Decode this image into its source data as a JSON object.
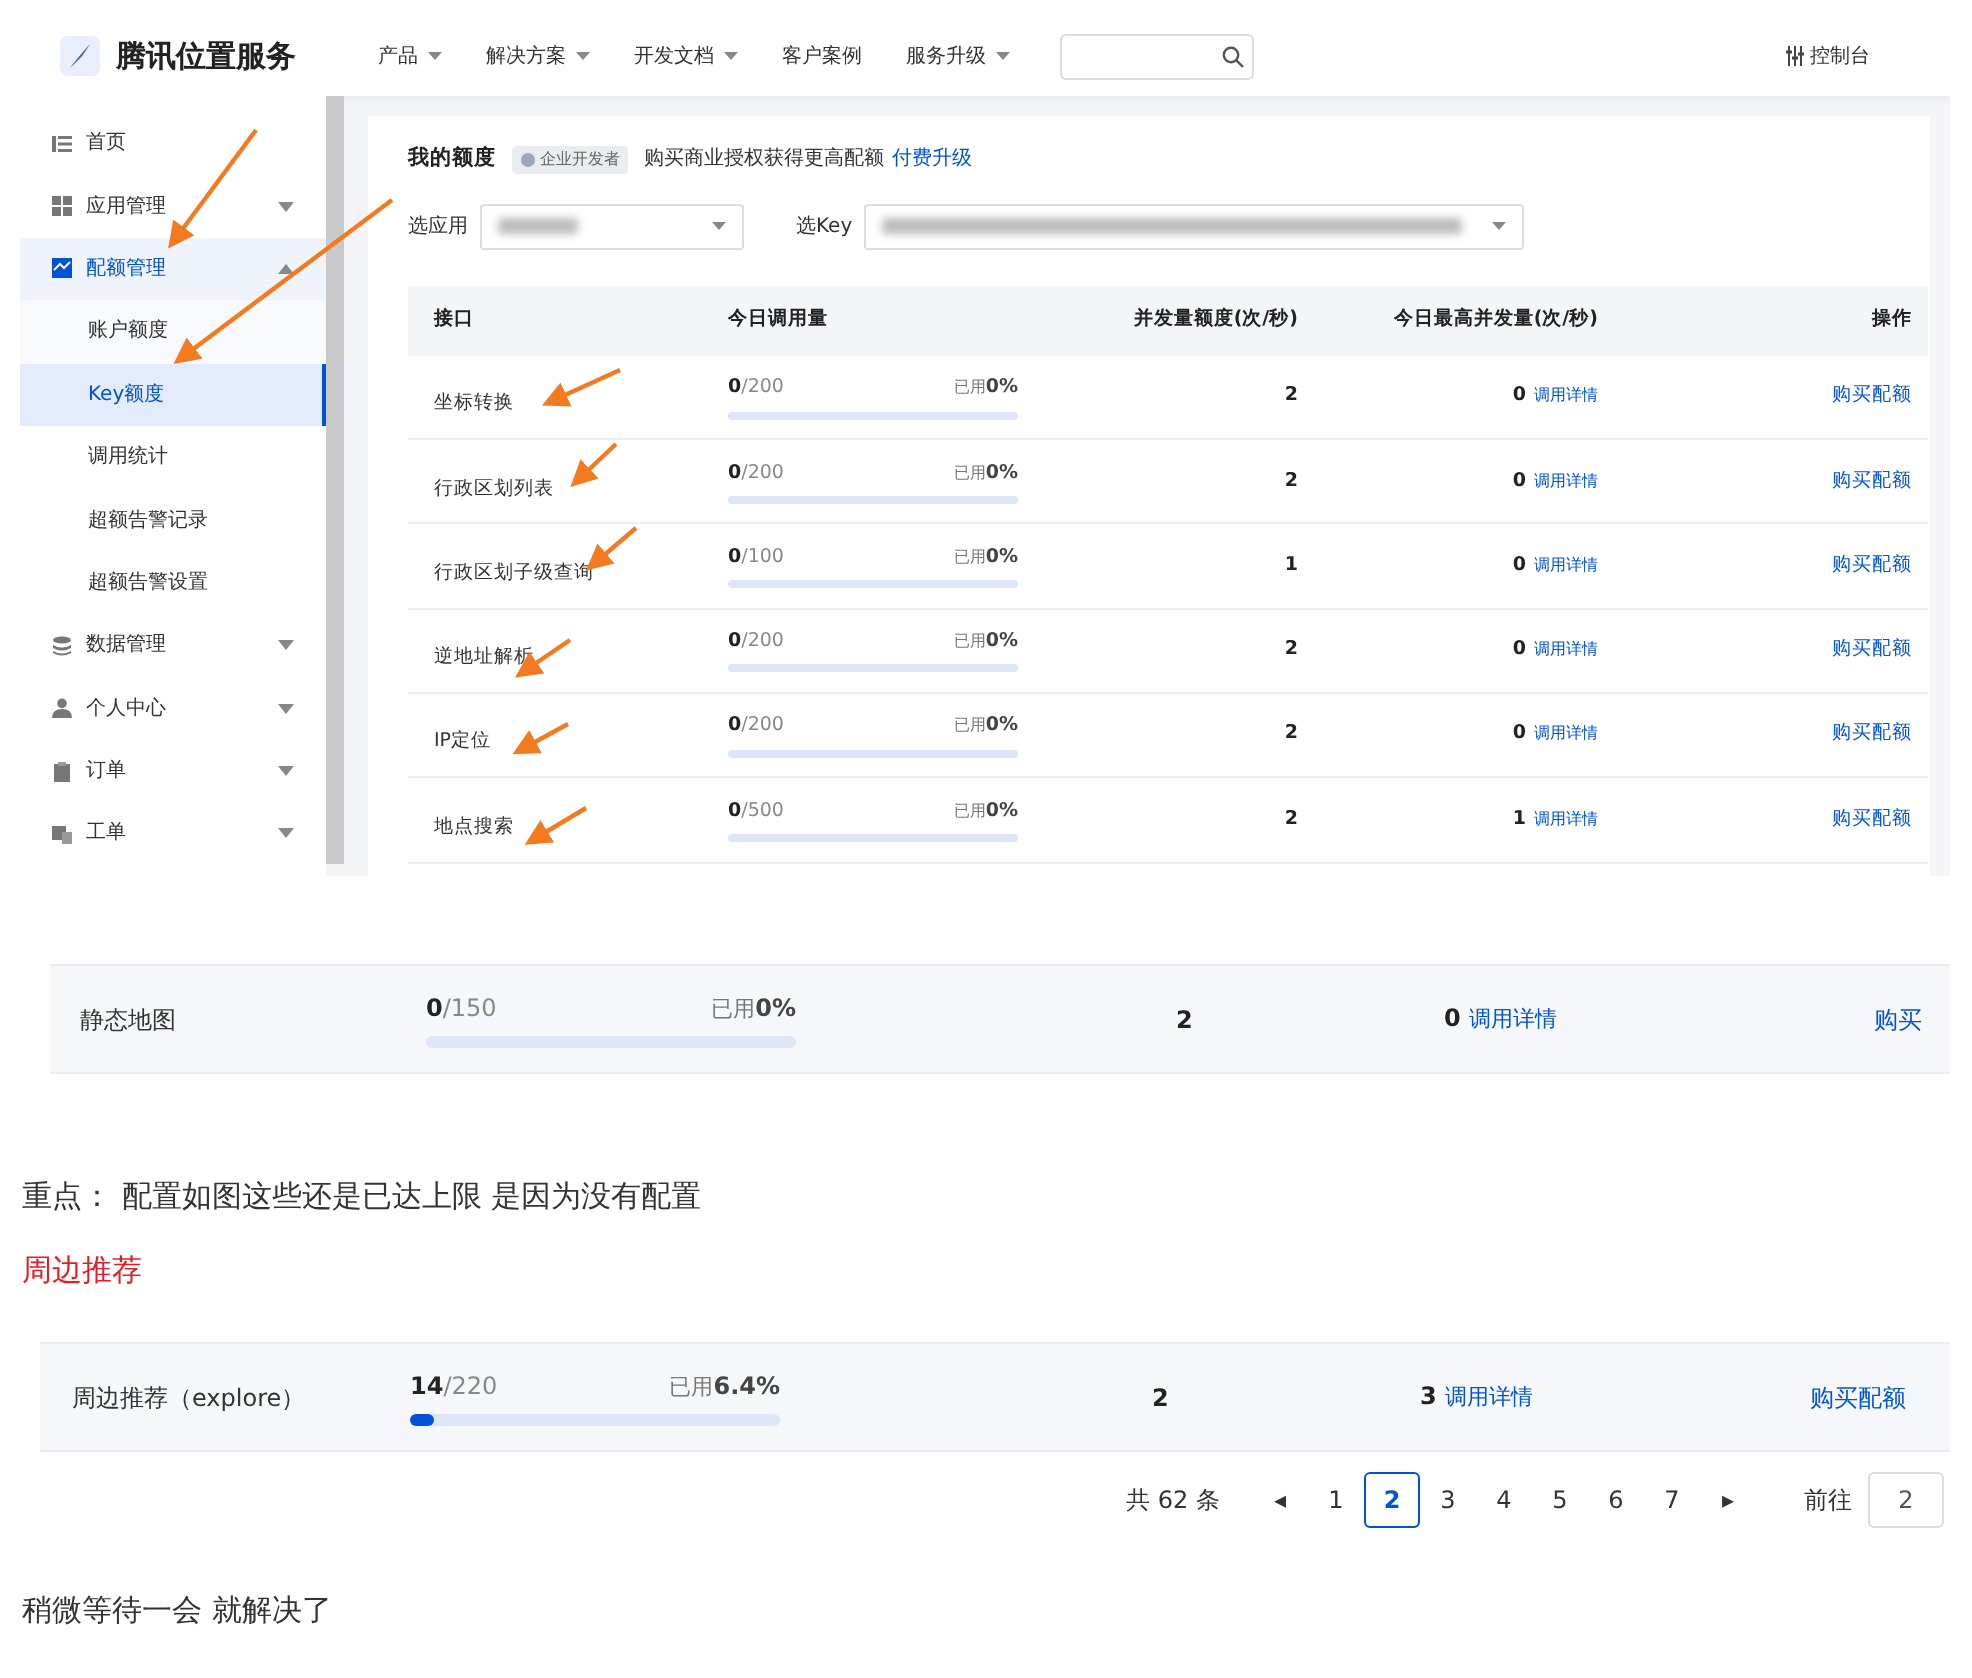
{
  "screenshot_1": {
    "header": {
      "logo_text": "腾讯位置服务",
      "nav": [
        {
          "label": "产品",
          "dropdown": true
        },
        {
          "label": "解决方案",
          "dropdown": true
        },
        {
          "label": "开发文档",
          "dropdown": true
        },
        {
          "label": "客户案例",
          "dropdown": false
        },
        {
          "label": "服务升级",
          "dropdown": true
        }
      ],
      "console": "控制台"
    },
    "sidebar": {
      "items": [
        {
          "label": "首页",
          "selected": false
        },
        {
          "label": "应用管理",
          "expanded": false,
          "selected": false
        },
        {
          "label": "配额管理",
          "expanded": true,
          "selected": true,
          "children": [
            {
              "label": "账户额度",
              "selected": false
            },
            {
              "label": "Key额度",
              "selected": true
            },
            {
              "label": "调用统计",
              "selected": false
            },
            {
              "label": "超额告警记录",
              "selected": false
            },
            {
              "label": "超额告警设置",
              "selected": false
            }
          ]
        },
        {
          "label": "数据管理",
          "expanded": false,
          "selected": false
        },
        {
          "label": "个人中心",
          "expanded": false,
          "selected": false
        },
        {
          "label": "订单",
          "expanded": false,
          "selected": false
        },
        {
          "label": "工单",
          "expanded": false,
          "selected": false
        }
      ]
    },
    "quota": {
      "title": "我的额度",
      "badge": "企业开发者",
      "promo": "购买商业授权获得更高配额",
      "upgrade_link": "付费升级",
      "app_label": "选应用",
      "key_label": "选Key",
      "table": {
        "columns": [
          "接口",
          "今日调用量",
          "并发量额度(次/秒)",
          "今日最高并发量(次/秒)",
          "操作"
        ],
        "rows": [
          {
            "name": "坐标转换",
            "usage": "**0**/200",
            "percent": "已用**0%**",
            "level": 0,
            "concurrency": "2",
            "peak": "0",
            "detail_link": "调用详情",
            "action": "购买配额"
          },
          {
            "name": "行政区划列表",
            "usage": "**0**/200",
            "percent": "已用**0%**",
            "level": 0,
            "concurrency": "2",
            "peak": "0",
            "detail_link": "调用详情",
            "action": "购买配额"
          },
          {
            "name": "行政区划子级查询",
            "usage": "**0**/100",
            "percent": "已用**0%**",
            "level": 0,
            "concurrency": "1",
            "peak": "0",
            "detail_link": "调用详情",
            "action": "购买配额"
          },
          {
            "name": "逆地址解析",
            "usage": "**0**/200",
            "percent": "已用**0%**",
            "level": 0,
            "concurrency": "2",
            "peak": "0",
            "detail_link": "调用详情",
            "action": "购买配额"
          },
          {
            "name": "IP定位",
            "usage": "**0**/200",
            "percent": "已用**0%**",
            "level": 0,
            "concurrency": "2",
            "peak": "0",
            "detail_link": "调用详情",
            "action": "购买配额"
          },
          {
            "name": "地点搜索",
            "usage": "**0**/500",
            "percent": "已用**0%**",
            "level": 0,
            "concurrency": "2",
            "peak": "1",
            "detail_link": "调用详情",
            "action": "购买配额"
          }
        ]
      }
    }
  },
  "screenshot_2": {
    "row": {
      "name": "静态地图",
      "usage": "**0**/150",
      "percent": "已用**0%**",
      "level": 0,
      "concurrency": "2",
      "peak": "0",
      "detail_link": "调用详情",
      "action": "购买"
    }
  },
  "note": "重点：  配置如图这些还是已达上限 是因为没有配置",
  "heading": "周边推荐",
  "screenshot_3": {
    "row": {
      "name": "周边推荐（explore）",
      "usage": "**14**/220",
      "percent": "已用**6.4%**",
      "level": 0.064,
      "concurrency": "2",
      "peak": "3",
      "detail_link": "调用详情",
      "action": "购买配额"
    },
    "pagination": {
      "total": "共 62 条",
      "prev": "◂",
      "pages": [
        {
          "label": "1",
          "selected": false
        },
        {
          "label": "2",
          "selected": true
        },
        {
          "label": "3",
          "selected": false
        },
        {
          "label": "4",
          "selected": false
        },
        {
          "label": "5",
          "selected": false
        },
        {
          "label": "6",
          "selected": false
        },
        {
          "label": "7",
          "selected": false
        }
      ],
      "next": "▸",
      "goto_label": "前往",
      "goto_value": "2"
    }
  },
  "closing": "稍微等待一会 就解决了"
}
